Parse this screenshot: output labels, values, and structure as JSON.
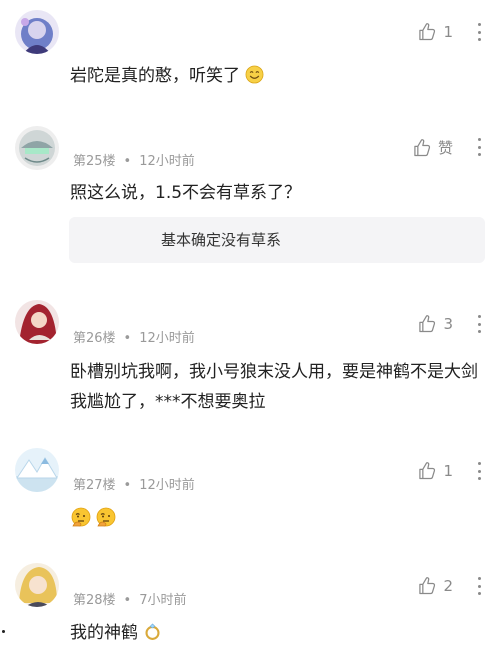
{
  "comments": [
    {
      "floor": "",
      "time": "",
      "likes": "1",
      "text": "岩陀是真的憨，听笑了",
      "emoji": "smile-emoji",
      "avatar": "avatar-anime-purple"
    },
    {
      "floor": "第25楼",
      "time": "12小时前",
      "likes": "赞",
      "text": "照这么说，1.5不会有草系了？",
      "reply": "基本确定没有草系",
      "avatar": "avatar-anime-gray"
    },
    {
      "floor": "第26楼",
      "time": "12小时前",
      "likes": "3",
      "text": "卧槽别坑我啊，我小号狼末没人用，要是神鹤不是大剑我尴尬了，***不想要奥拉",
      "avatar": "avatar-anime-red"
    },
    {
      "floor": "第27楼",
      "time": "12小时前",
      "likes": "1",
      "text": "",
      "emoji": "thinking-emoji-x2",
      "avatar": "avatar-snow-landscape"
    },
    {
      "floor": "第28楼",
      "time": "7小时前",
      "likes": "2",
      "text": "我的神鹤",
      "emoji": "ring-emoji",
      "avatar": "avatar-anime-blonde"
    }
  ],
  "separator": "•",
  "colors": {
    "meta": "#9a9a9a",
    "text": "#222222",
    "reply_bg": "#f4f4f6",
    "icon": "#8a8a8a"
  }
}
